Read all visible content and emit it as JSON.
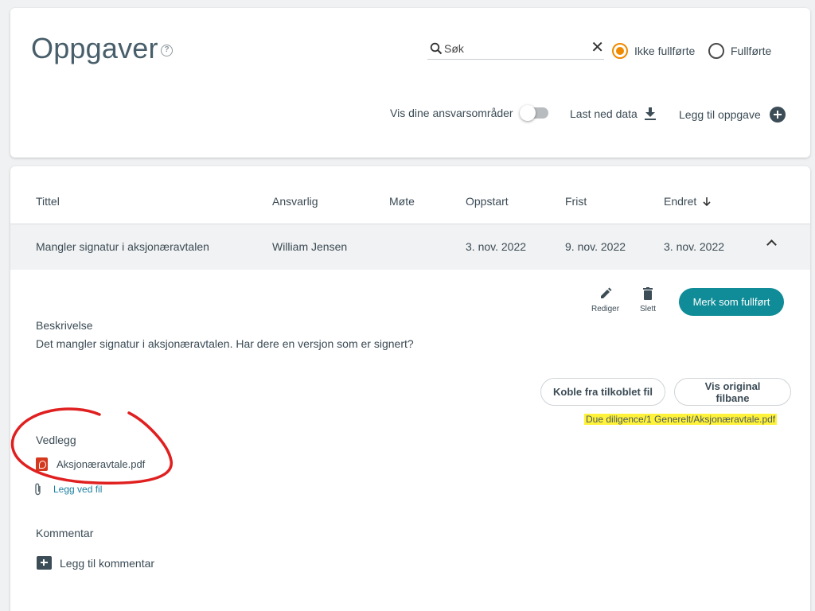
{
  "header": {
    "title": "Oppgaver",
    "search": {
      "placeholder": "Søk",
      "value": ""
    },
    "filters": [
      {
        "label": "Ikke fullførte",
        "checked": true
      },
      {
        "label": "Fullførte",
        "checked": false
      }
    ],
    "toolbar": {
      "responsibility_label": "Vis dine ansvarsområder",
      "responsibility_enabled": false,
      "download_label": "Last ned data",
      "add_task_label": "Legg til oppgave"
    }
  },
  "table": {
    "columns": [
      "Tittel",
      "Ansvarlig",
      "Møte",
      "Oppstart",
      "Frist",
      "Endret"
    ],
    "sort_column": "Endret",
    "sort_direction": "descending",
    "rows": [
      {
        "title": "Mangler signatur i aksjonæravtalen",
        "responsible": "William Jensen",
        "meeting": "",
        "start": "3. nov. 2022",
        "due": "9. nov. 2022",
        "changed": "3. nov. 2022",
        "expanded": true
      }
    ]
  },
  "detail": {
    "edit_label": "Rediger",
    "delete_label": "Slett",
    "complete_button": "Merk som fullført",
    "description_label": "Beskrivelse",
    "description_text": "Det mangler signatur i aksjonæravtalen. Har dere en versjon som er signert?",
    "detach_button": "Koble fra tilkoblet fil",
    "show_path_button": "Vis original filbane",
    "original_path": "Due diligence/1 Generelt/Aksjonæravtale.pdf",
    "attachments_label": "Vedlegg",
    "attachments": [
      {
        "name": "Aksjonæravtale.pdf",
        "icon": "pdf-file-icon"
      }
    ],
    "add_file_label": "Legg ved fil",
    "comment_label": "Kommentar",
    "add_comment_label": "Legg til kommentar"
  },
  "colors": {
    "primary": "#0f8c97",
    "radio_checked": "#f08a00",
    "highlight": "#fff23a",
    "annotation": "#e02020"
  }
}
